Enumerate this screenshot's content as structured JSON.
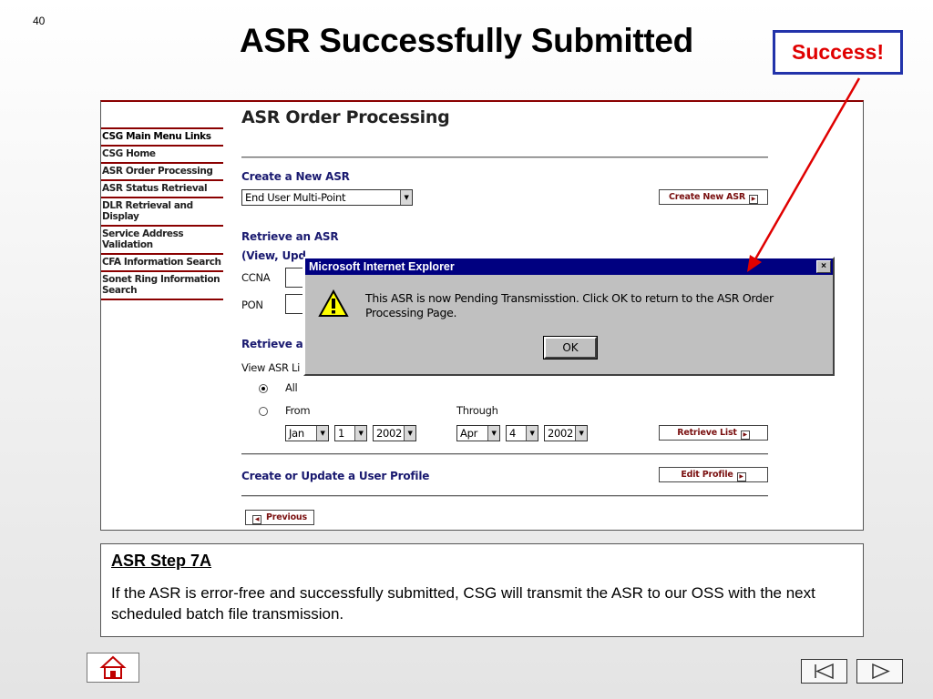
{
  "slide": {
    "number": "40",
    "title": "ASR Successfully Submitted",
    "callout": "Success!"
  },
  "sidebar": {
    "header": "CSG Main Menu Links",
    "items": [
      {
        "label": "CSG Home"
      },
      {
        "label": "ASR Order Processing"
      },
      {
        "label": "ASR Status Retrieval"
      },
      {
        "label": "DLR Retrieval and Display"
      },
      {
        "label": "Service Address Validation"
      },
      {
        "label": "CFA Information Search"
      },
      {
        "label": "Sonet Ring Information Search"
      }
    ]
  },
  "main": {
    "title": "ASR Order Processing",
    "create_section": "Create a New ASR",
    "create_select": "End User Multi-Point",
    "create_button": "Create New ASR",
    "retrieve_section": "Retrieve an ASR",
    "retrieve_sub": "(View, Upd",
    "ccna_label": "CCNA",
    "pon_label": "PON",
    "retrieve_list_section": "Retrieve a",
    "view_list_label": "View ASR Li",
    "radio_all": "All",
    "radio_from": "From",
    "through_label": "Through",
    "from_month": "Jan",
    "from_day": "1",
    "from_year": "2002",
    "to_month": "Apr",
    "to_day": "4",
    "to_year": "2002",
    "retrieve_list_button": "Retrieve List",
    "profile_section": "Create or Update a User Profile",
    "edit_profile_button": "Edit Profile",
    "previous_button": "Previous"
  },
  "dialog": {
    "title": "Microsoft Internet Explorer",
    "close": "×",
    "message": "This ASR is now Pending Transmisstion.  Click OK to return to the ASR Order Processing Page.",
    "ok": "OK"
  },
  "step": {
    "title": "ASR Step 7A",
    "text": "If the ASR is error-free and successfully submitted, CSG will transmit the ASR to our OSS with the next scheduled batch file transmission."
  },
  "colors": {
    "accent_red": "#8a0000",
    "callout_border": "#2233aa",
    "callout_text": "#e00000",
    "dialog_titlebar": "#000080"
  },
  "icons": [
    "warning-icon",
    "home-icon",
    "first-page-icon",
    "next-page-icon"
  ]
}
